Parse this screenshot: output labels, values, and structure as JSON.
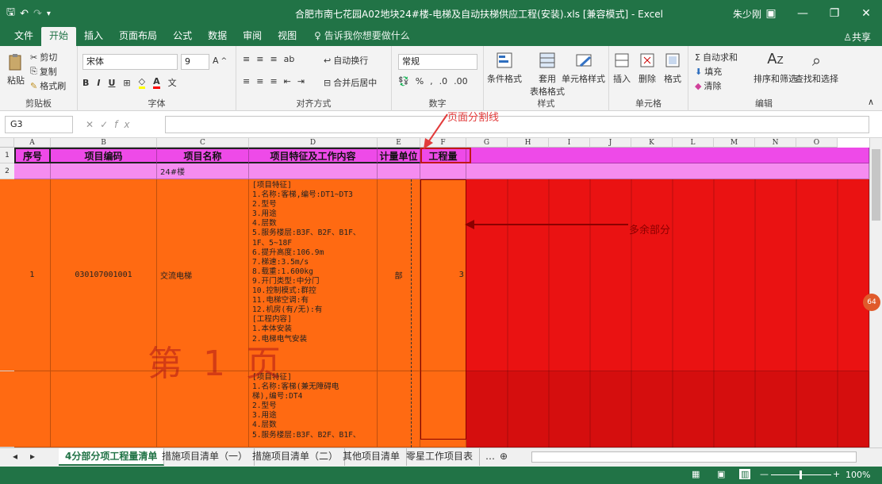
{
  "window": {
    "title": "合肥市南七花园A02地块24#楼-电梯及自动扶梯供应工程(安装).xls  [兼容模式]  -  Excel",
    "user": "朱少刚",
    "share": "共享"
  },
  "ribbon_tabs": [
    "文件",
    "开始",
    "插入",
    "页面布局",
    "公式",
    "数据",
    "审阅",
    "视图"
  ],
  "tell_me": "告诉我你想要做什么",
  "ribbon": {
    "clipboard": {
      "paste": "粘贴",
      "cut": "剪切",
      "copy": "复制",
      "format_painter": "格式刷",
      "label": "剪贴板"
    },
    "font": {
      "name": "宋体",
      "size": "9",
      "label": "字体"
    },
    "alignment": {
      "wrap": "自动换行",
      "merge": "合并后居中",
      "label": "对齐方式"
    },
    "number": {
      "format": "常规",
      "label": "数字"
    },
    "styles": {
      "conditional": "条件格式",
      "table": "套用\n表格格式",
      "cell_styles": "单元格样式",
      "label": "样式"
    },
    "cells": {
      "insert": "插入",
      "delete": "删除",
      "format": "格式",
      "label": "单元格"
    },
    "editing": {
      "autosum": "自动求和",
      "fill": "填充",
      "clear": "清除",
      "sort": "排序和筛选",
      "find": "查找和选择",
      "label": "编辑"
    }
  },
  "namebox": "G3",
  "annotations": {
    "page_break": "页面分割线",
    "extra": "多余部分",
    "page": "第 1 页"
  },
  "columns": [
    "A",
    "B",
    "C",
    "D",
    "E",
    "F",
    "G",
    "H",
    "I",
    "J",
    "K",
    "L",
    "M",
    "N",
    "O"
  ],
  "headers": [
    "序号",
    "项目编码",
    "项目名称",
    "项目特征及工作内容",
    "计量单位",
    "工程量"
  ],
  "rows": {
    "r1": "1",
    "r2": "2",
    "r2_name": "24#楼",
    "seq": "1",
    "code": "030107001001",
    "name": "交流电梯",
    "unit": "部",
    "qty": "3",
    "feature1": "[项目特征]\n1.名称:客梯,编号:DT1~DT3\n2.型号\n3.用途\n4.层数\n5.服务楼层:B3F、B2F、B1F、\n1F、5~18F\n6.提升高度:106.9m\n7.梯速:3.5m/s\n8.载重:1.600kg\n9.开门类型:中分门\n10.控制模式:群控\n11.电梯空调:有\n12.机房(有/无):有\n[工程内容]\n1.本体安装\n2.电梯电气安装",
    "feature2": "[项目特征]\n1.名称:客梯(兼无障碍电\n梯),编号:DT4\n2.型号\n3.用途\n4.层数\n5.服务楼层:B3F、B2F、B1F、"
  },
  "sheet_tabs": [
    "4分部分项工程量清单",
    "措施项目清单（一）",
    "措施项目清单（二）",
    "其他项目清单",
    "零星工作项目表"
  ],
  "status": {
    "zoom": "100%",
    "badge": "64"
  },
  "colors": {
    "excel_green": "#217346",
    "orange": "#ff6a12",
    "red": "#ea1212",
    "magenta": "#ee4ae8",
    "annotation_red": "#e23b3b"
  }
}
